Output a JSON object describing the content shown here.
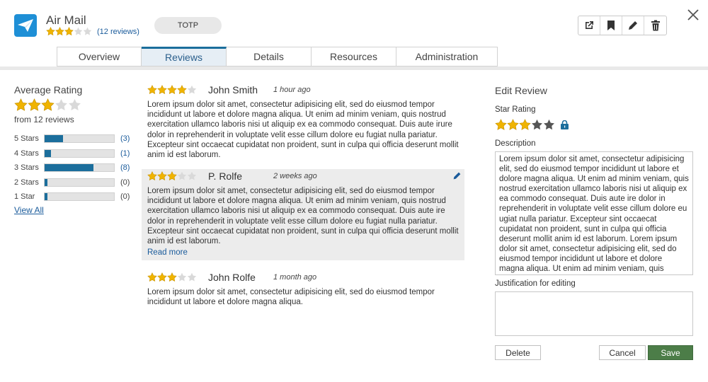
{
  "app": {
    "title": "Air Mail",
    "rating": 3,
    "reviews_link": "(12 reviews)",
    "tag": "TOTP",
    "icon": "paper-plane-icon",
    "brand_color": "#1e8fd6"
  },
  "toolbar": {
    "icons": [
      "open-external-icon",
      "bookmark-icon",
      "pencil-icon",
      "trash-icon"
    ]
  },
  "tabs": [
    {
      "label": "Overview",
      "active": false
    },
    {
      "label": "Reviews",
      "active": true
    },
    {
      "label": "Details",
      "active": false
    },
    {
      "label": "Resources",
      "active": false
    },
    {
      "label": "Administration",
      "active": false
    }
  ],
  "summary": {
    "title": "Average Rating",
    "rating": 3,
    "count_text": "from 12 reviews",
    "distribution": [
      {
        "label": "5 Stars",
        "count": 3,
        "count_text": "(3)"
      },
      {
        "label": "4 Stars",
        "count": 1,
        "count_text": "(1)"
      },
      {
        "label": "3 Stars",
        "count": 8,
        "count_text": "(8)"
      },
      {
        "label": "2 Stars",
        "count": 0,
        "count_text": "(0)"
      },
      {
        "label": "1 Star",
        "count": 0,
        "count_text": "(0)"
      }
    ],
    "view_all": "View All"
  },
  "reviews": [
    {
      "name": "John Smith",
      "time": "1 hour ago",
      "rating": 4,
      "text": "Lorem ipsum dolor sit amet, consectetur adipisicing elit, sed do eiusmod tempor incididunt ut labore et dolore magna aliqua. Ut enim ad minim veniam, quis nostrud exercitation ullamco laboris nisi ut aliquip ex ea commodo consequat. Duis aute irure dolor in reprehenderit in voluptate velit esse cillum dolore eu fugiat nulla pariatur. Excepteur sint occaecat cupidatat non proident, sunt in culpa qui officia deserunt mollit anim id est laborum."
    },
    {
      "name": "P. Rolfe",
      "time": "2 weeks ago",
      "rating": 3,
      "text": "Lorem ipsum dolor sit amet, consectetur adipisicing elit, sed do eiusmod tempor incididunt ut labore et dolore magna aliqua. Ut enim ad minim veniam, quis nostrud exercitation ullamco laboris nisi ut aliquip ex ea commodo consequat. Duis aute ire dolor in reprehenderit in voluptate velit esse cillum dolore eu fugiat nulla pariatur. Excepteur sint occaecat cupidatat non proident, sunt in culpa qui officia deserunt mollit anim id est laborum.",
      "read_more": "Read more"
    },
    {
      "name": "John Rolfe",
      "time": "1 month ago",
      "rating": 3,
      "text": "Lorem ipsum dolor sit amet, consectetur adipisicing elit, sed do eiusmod tempor incididunt ut labore et dolore magna aliqua."
    }
  ],
  "edit": {
    "title": "Edit Review",
    "star_label": "Star Rating",
    "rating": 3,
    "description_label": "Description",
    "description": "Lorem ipsum dolor sit amet, consectetur adipisicing elit, sed do eiusmod tempor incididunt ut labore et dolore magna aliqua. Ut enim ad minim veniam, quis nostrud exercitation ullamco laboris nisi ut aliquip ex ea commodo consequat. Duis aute ire dolor in reprehenderit in voluptate velit esse cillum dolore eu ugiat nulla pariatur. Excepteur sint occaecat cupidatat non proident, sunt in culpa qui officia deserunt mollit anim id est laborum. Lorem ipsum dolor sit amet, consectetur adipisicing elit, sed do eiusmod tempor incididunt ut labore et dolore magna aliqua. Ut enim ad minim veniam, quis",
    "justification_label": "Justification for editing",
    "justification": "",
    "delete_label": "Delete",
    "cancel_label": "Cancel",
    "save_label": "Save",
    "save_color": "#4c7d48"
  },
  "colors": {
    "star_filled": "#f0b400",
    "star_empty": "#d9d9d9",
    "accent": "#1b6e9c",
    "link": "#1a5b9b"
  }
}
